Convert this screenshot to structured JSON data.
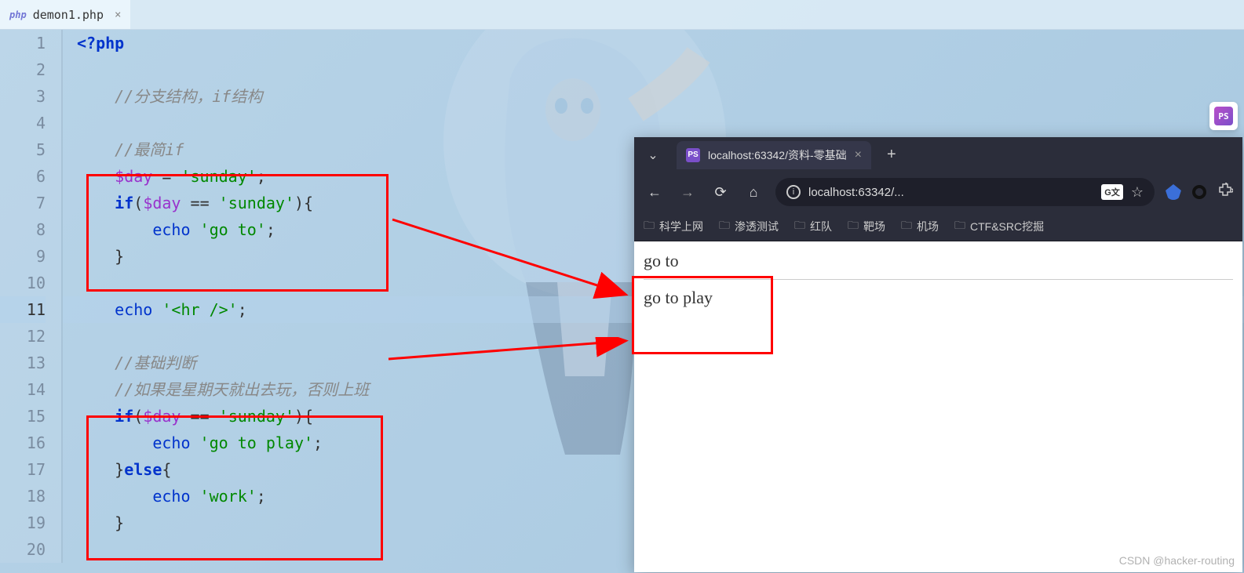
{
  "editor": {
    "tab": {
      "icon_label": "php",
      "filename": "demon1.php"
    },
    "lines": [
      {
        "n": 1,
        "tokens": [
          {
            "t": "<?php",
            "c": "php-tag"
          }
        ]
      },
      {
        "n": 2,
        "tokens": []
      },
      {
        "n": 3,
        "indent": "    ",
        "tokens": [
          {
            "t": "//分支结构，if结构",
            "c": "comment"
          }
        ]
      },
      {
        "n": 4,
        "tokens": []
      },
      {
        "n": 5,
        "indent": "    ",
        "tokens": [
          {
            "t": "//最简if",
            "c": "comment"
          }
        ]
      },
      {
        "n": 6,
        "indent": "    ",
        "tokens": [
          {
            "t": "$day",
            "c": "variable"
          },
          {
            "t": " = ",
            "c": "operator"
          },
          {
            "t": "'sunday'",
            "c": "string"
          },
          {
            "t": ";",
            "c": "operator"
          }
        ]
      },
      {
        "n": 7,
        "indent": "    ",
        "tokens": [
          {
            "t": "if",
            "c": "keyword"
          },
          {
            "t": "(",
            "c": "operator"
          },
          {
            "t": "$day",
            "c": "variable"
          },
          {
            "t": " == ",
            "c": "operator"
          },
          {
            "t": "'sunday'",
            "c": "string"
          },
          {
            "t": "){",
            "c": "operator"
          }
        ]
      },
      {
        "n": 8,
        "indent": "        ",
        "tokens": [
          {
            "t": "echo",
            "c": "echo-kw"
          },
          {
            "t": " ",
            "c": "operator"
          },
          {
            "t": "'go to'",
            "c": "string"
          },
          {
            "t": ";",
            "c": "operator"
          }
        ]
      },
      {
        "n": 9,
        "indent": "    ",
        "tokens": [
          {
            "t": "}",
            "c": "operator"
          }
        ]
      },
      {
        "n": 10,
        "tokens": []
      },
      {
        "n": 11,
        "indent": "    ",
        "current": true,
        "tokens": [
          {
            "t": "echo",
            "c": "echo-kw"
          },
          {
            "t": " ",
            "c": "operator"
          },
          {
            "t": "'<hr />'",
            "c": "string"
          },
          {
            "t": ";",
            "c": "operator"
          }
        ]
      },
      {
        "n": 12,
        "tokens": []
      },
      {
        "n": 13,
        "indent": "    ",
        "tokens": [
          {
            "t": "//基础判断",
            "c": "comment"
          }
        ]
      },
      {
        "n": 14,
        "indent": "    ",
        "tokens": [
          {
            "t": "//如果是星期天就出去玩，否则上班",
            "c": "comment"
          }
        ]
      },
      {
        "n": 15,
        "indent": "    ",
        "tokens": [
          {
            "t": "if",
            "c": "keyword"
          },
          {
            "t": "(",
            "c": "operator"
          },
          {
            "t": "$day",
            "c": "variable"
          },
          {
            "t": " == ",
            "c": "operator"
          },
          {
            "t": "'sunday'",
            "c": "string"
          },
          {
            "t": "){",
            "c": "operator"
          }
        ]
      },
      {
        "n": 16,
        "indent": "        ",
        "tokens": [
          {
            "t": "echo",
            "c": "echo-kw"
          },
          {
            "t": " ",
            "c": "operator"
          },
          {
            "t": "'go to play'",
            "c": "string"
          },
          {
            "t": ";",
            "c": "operator"
          }
        ]
      },
      {
        "n": 17,
        "indent": "    ",
        "tokens": [
          {
            "t": "}",
            "c": "operator"
          },
          {
            "t": "else",
            "c": "keyword"
          },
          {
            "t": "{",
            "c": "operator"
          }
        ]
      },
      {
        "n": 18,
        "indent": "        ",
        "tokens": [
          {
            "t": "echo",
            "c": "echo-kw"
          },
          {
            "t": " ",
            "c": "operator"
          },
          {
            "t": "'work'",
            "c": "string"
          },
          {
            "t": ";",
            "c": "operator"
          }
        ]
      },
      {
        "n": 19,
        "indent": "    ",
        "tokens": [
          {
            "t": "}",
            "c": "operator"
          }
        ]
      },
      {
        "n": 20,
        "tokens": []
      }
    ]
  },
  "browser": {
    "tab_title": "localhost:63342/资料-零基础",
    "url_display": "localhost:63342/...",
    "bookmarks": [
      "科学上网",
      "渗透测试",
      "红队",
      "靶场",
      "机场",
      "CTF&SRC挖掘"
    ],
    "output_line1": "go to",
    "output_line2": "go to play"
  },
  "watermark": "CSDN @hacker-routing",
  "ps_badge": "PS"
}
